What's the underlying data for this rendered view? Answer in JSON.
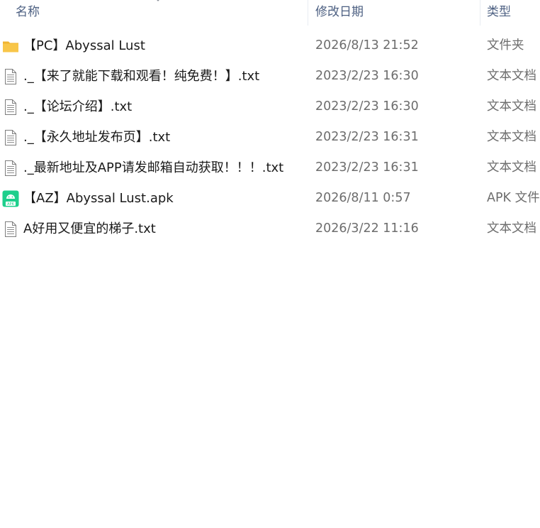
{
  "header": {
    "name_label": "名称",
    "date_label": "修改日期",
    "type_label": "类型"
  },
  "files": [
    {
      "name": "【PC】Abyssal Lust",
      "date": "2026/8/13 21:52",
      "type": "文件夹",
      "icon": "folder-icon"
    },
    {
      "name": "._【来了就能下载和观看！纯免费！】.txt",
      "date": "2023/2/23 16:30",
      "type": "文本文档",
      "icon": "text-file-icon"
    },
    {
      "name": "._【论坛介绍】.txt",
      "date": "2023/2/23 16:30",
      "type": "文本文档",
      "icon": "text-file-icon"
    },
    {
      "name": "._【永久地址发布页】.txt",
      "date": "2023/2/23 16:31",
      "type": "文本文档",
      "icon": "text-file-icon"
    },
    {
      "name": "._最新地址及APP请发邮箱自动获取！！！.txt",
      "date": "2023/2/23 16:31",
      "type": "文本文档",
      "icon": "text-file-icon"
    },
    {
      "name": "【AZ】Abyssal Lust.apk",
      "date": "2026/8/11 0:57",
      "type": "APK 文件",
      "icon": "apk-file-icon"
    },
    {
      "name": "A好用又便宜的梯子.txt",
      "date": "2026/3/22 11:16",
      "type": "文本文档",
      "icon": "text-file-icon"
    }
  ],
  "colors": {
    "header_text": "#4d6082",
    "name_text": "#1a1a1a",
    "meta_text": "#6d6d6d",
    "folder_yellow": "#f8c649",
    "apk_green": "#1ecf8c"
  }
}
